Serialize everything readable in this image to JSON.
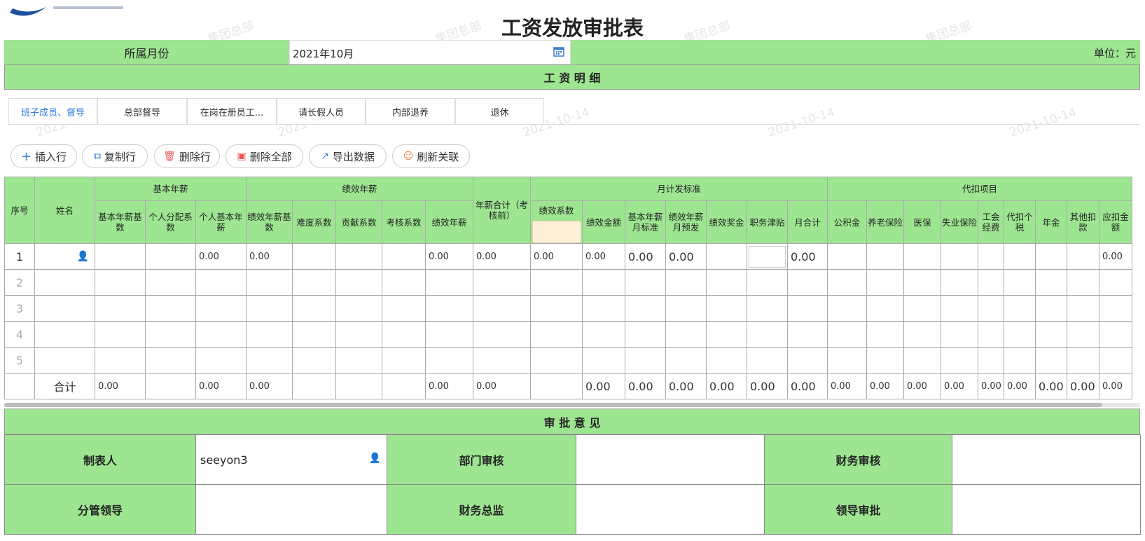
{
  "title": "工资发放审批表",
  "month": {
    "label": "所属月份",
    "value": "2021年10月",
    "unit": "单位：元"
  },
  "section_salary": "工 资 明 细",
  "tabs": [
    {
      "label": "班子成员、督导",
      "active": true
    },
    {
      "label": "总部督导"
    },
    {
      "label": "在岗在册员工..."
    },
    {
      "label": "请长假人员"
    },
    {
      "label": "内部退养"
    },
    {
      "label": "退休"
    }
  ],
  "toolbar": {
    "insert": "插入行",
    "copy": "复制行",
    "delete": "删除行",
    "delete_all": "删除全部",
    "export": "导出数据",
    "refresh": "刷新关联"
  },
  "headers": {
    "idx": "序号",
    "name": "姓名",
    "group_basic": "基本年薪",
    "group_perf": "绩效年薪",
    "total_before": "年薪合计（考核前）",
    "group_monthly": "月计发标准",
    "group_deduct": "代扣项目",
    "cols": [
      "基本年薪基数",
      "个人分配系数",
      "个人基本年薪",
      "绩效年薪基数",
      "难度系数",
      "贡献系数",
      "考核系数",
      "绩效年薪",
      "绩效系数",
      "绩效金额",
      "基本年薪月标准",
      "绩效年薪月预发",
      "绩效奖金",
      "职务津贴",
      "月合计",
      "公积金",
      "养老保险",
      "医保",
      "失业保险",
      "工会经费",
      "代扣个税",
      "年金",
      "其他扣款",
      "应扣金额"
    ]
  },
  "rows": [
    {
      "idx": "1",
      "c2": "0.00",
      "c3": "0.00",
      "c7": "0.00",
      "c8": "0.00",
      "c9": "0.00",
      "c10": "0.00",
      "c11": "0.00",
      "c12": "0.00",
      "c15": "0.00",
      "c24": "0.00"
    },
    {
      "idx": "2"
    },
    {
      "idx": "3"
    },
    {
      "idx": "4"
    },
    {
      "idx": "5"
    }
  ],
  "total": {
    "label": "合计",
    "values": [
      "0.00",
      "",
      "0.00",
      "0.00",
      "",
      "",
      "",
      "0.00",
      "0.00",
      "",
      "0.00",
      "0.00",
      "0.00",
      "0.00",
      "0.00",
      "0.00",
      "0.00",
      "0.00",
      "0.00",
      "0.00",
      "0.00",
      "0.00",
      "0.00",
      "0.00",
      "0.00"
    ]
  },
  "approval": {
    "title": "审 批 意 见",
    "maker_label": "制表人",
    "maker_value": "seeyon3",
    "dept_label": "部门审核",
    "finance_label": "财务审核",
    "leader_label": "分管领导",
    "cfo_label": "财务总监",
    "boss_label": "领导审批"
  },
  "watermark": {
    "org": "集团总部",
    "date": "2021-10-14"
  }
}
